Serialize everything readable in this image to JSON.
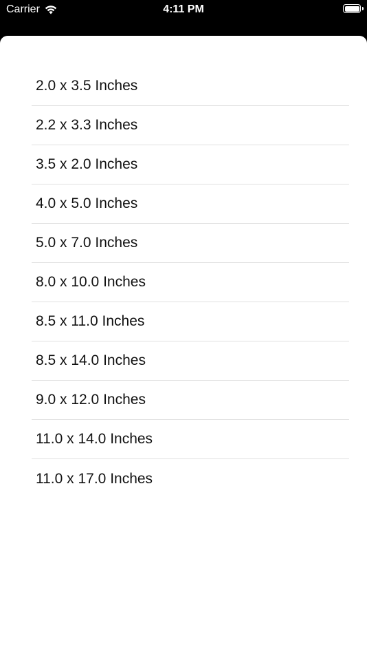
{
  "status_bar": {
    "carrier": "Carrier",
    "time": "4:11 PM",
    "battery_level": 1.0
  },
  "sizes": [
    "2.0 x 3.5 Inches",
    "2.2 x 3.3 Inches",
    "3.5 x 2.0 Inches",
    "4.0 x 5.0 Inches",
    "5.0 x 7.0 Inches",
    "8.0 x 10.0 Inches",
    "8.5 x 11.0 Inches",
    "8.5 x 14.0 Inches",
    "9.0 x 12.0 Inches",
    "11.0 x 14.0 Inches",
    "11.0 x 17.0 Inches"
  ],
  "colors": {
    "background": "#000000",
    "sheet": "#ffffff",
    "separator": "#e0e0e0",
    "text": "#111111"
  },
  "icons": {
    "wifi": "wifi-icon",
    "battery": "battery-icon"
  }
}
